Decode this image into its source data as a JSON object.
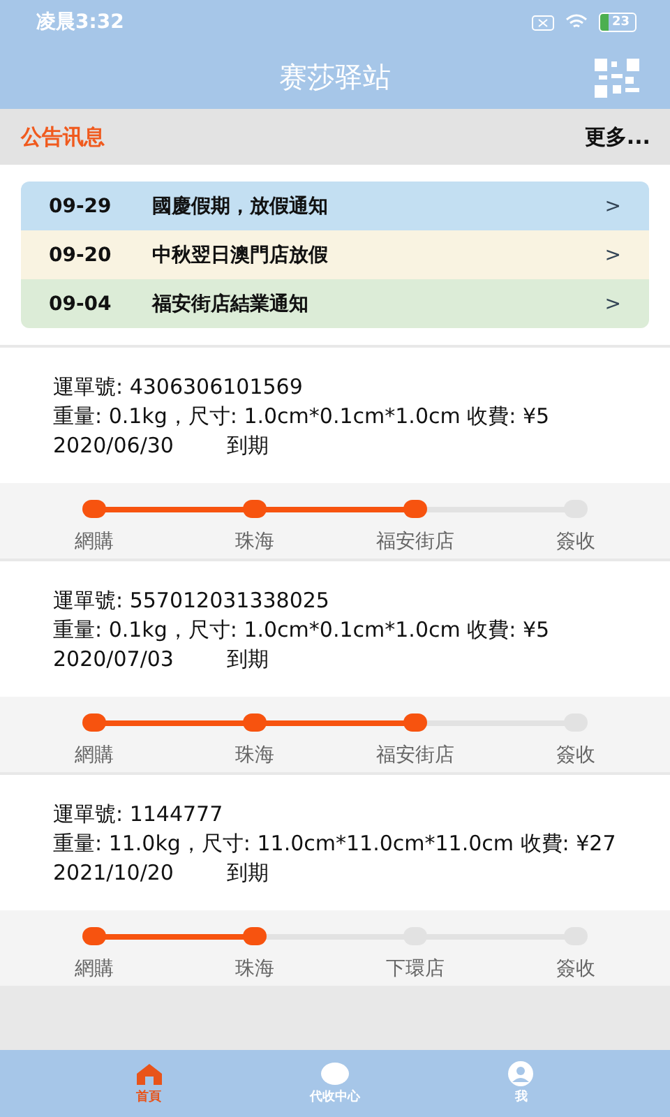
{
  "status_bar": {
    "time": "凌晨3:32",
    "battery": "23"
  },
  "header": {
    "title": "赛莎驿站"
  },
  "notices": {
    "title": "公告讯息",
    "more": "更多...",
    "items": [
      {
        "date": "09-29",
        "text": "國慶假期，放假通知",
        "arrow": ">",
        "color": "#c3dff2"
      },
      {
        "date": "09-20",
        "text": "中秋翌日澳門店放假",
        "arrow": ">",
        "color": "#f9f3e1"
      },
      {
        "date": "09-04",
        "text": "福安街店結業通知",
        "arrow": ">",
        "color": "#dcecd7"
      }
    ]
  },
  "orders": [
    {
      "waybill": "運單號: 4306306101569",
      "details": "重量: 0.1kg，尺寸: 1.0cm*0.1cm*1.0cm 收費: ¥5",
      "date": "2020/06/30",
      "due": "到期",
      "steps": [
        {
          "label": "網購",
          "done": true
        },
        {
          "label": "珠海",
          "done": true
        },
        {
          "label": "福安街店",
          "done": true
        },
        {
          "label": "簽收",
          "done": false
        }
      ]
    },
    {
      "waybill": "運單號: 557012031338025",
      "details": "重量: 0.1kg，尺寸: 1.0cm*0.1cm*1.0cm 收費: ¥5",
      "date": "2020/07/03",
      "due": "到期",
      "steps": [
        {
          "label": "網購",
          "done": true
        },
        {
          "label": "珠海",
          "done": true
        },
        {
          "label": "福安街店",
          "done": true
        },
        {
          "label": "簽收",
          "done": false
        }
      ]
    },
    {
      "waybill": "運單號: 1144777",
      "details": "重量: 11.0kg，尺寸: 11.0cm*11.0cm*11.0cm 收費: ¥27",
      "date": "2021/10/20",
      "due": "到期",
      "steps": [
        {
          "label": "網購",
          "done": true
        },
        {
          "label": "珠海",
          "done": true
        },
        {
          "label": "下環店",
          "done": false
        },
        {
          "label": "簽收",
          "done": false
        }
      ]
    }
  ],
  "tabs": [
    {
      "kind": "home",
      "label": "首頁",
      "selected": true
    },
    {
      "kind": "collect",
      "label": "代收中心",
      "selected": false
    },
    {
      "kind": "me",
      "label": "我",
      "selected": false
    }
  ]
}
